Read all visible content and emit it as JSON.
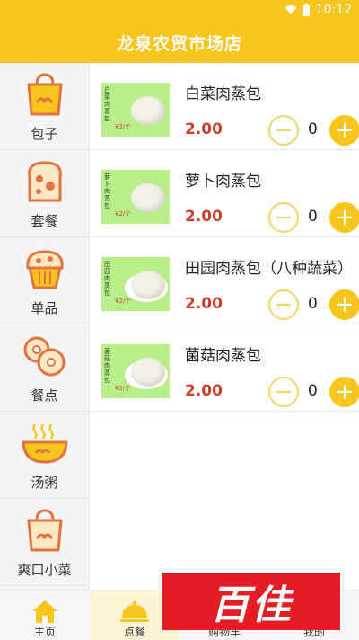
{
  "status_bar": {
    "time": "10:12"
  },
  "app_bar": {
    "title": "龙泉农贸市场店"
  },
  "sidebar": {
    "items": [
      {
        "label": "包子",
        "icon": "bag-icon"
      },
      {
        "label": "套餐",
        "icon": "toast-icon"
      },
      {
        "label": "单品",
        "icon": "muffin-icon"
      },
      {
        "label": "餐点",
        "icon": "donut-icon"
      },
      {
        "label": "汤粥",
        "icon": "soup-bowl-icon"
      },
      {
        "label": "爽口小菜",
        "icon": "bag-icon"
      }
    ]
  },
  "products": [
    {
      "name": "白菜肉蒸包",
      "price": "2.00",
      "qty": "0",
      "image_text": "白菜肉蒸包",
      "image_tag": "¥2/个"
    },
    {
      "name": "萝卜肉蒸包",
      "price": "2.00",
      "qty": "0",
      "image_text": "萝卜肉蒸包",
      "image_tag": "¥2/个"
    },
    {
      "name": "田园肉蒸包（八种蔬菜）",
      "price": "2.00",
      "qty": "0",
      "image_text": "田园肉蒸包",
      "image_tag": "¥2/个"
    },
    {
      "name": "菌菇肉蒸包",
      "price": "2.00",
      "qty": "0",
      "image_text": "菌菇肉蒸包",
      "image_tag": "¥2/个"
    }
  ],
  "bottom_nav": {
    "tabs": [
      {
        "label": "主页"
      },
      {
        "label": "点餐"
      },
      {
        "label": "购物车"
      },
      {
        "label": "我的"
      }
    ]
  },
  "watermark": {
    "text": "百佳"
  },
  "colors": {
    "accent": "#f7c51d",
    "price": "#c9422c",
    "icon_line": "#e0733f",
    "icon_fill": "#f7c51d"
  }
}
